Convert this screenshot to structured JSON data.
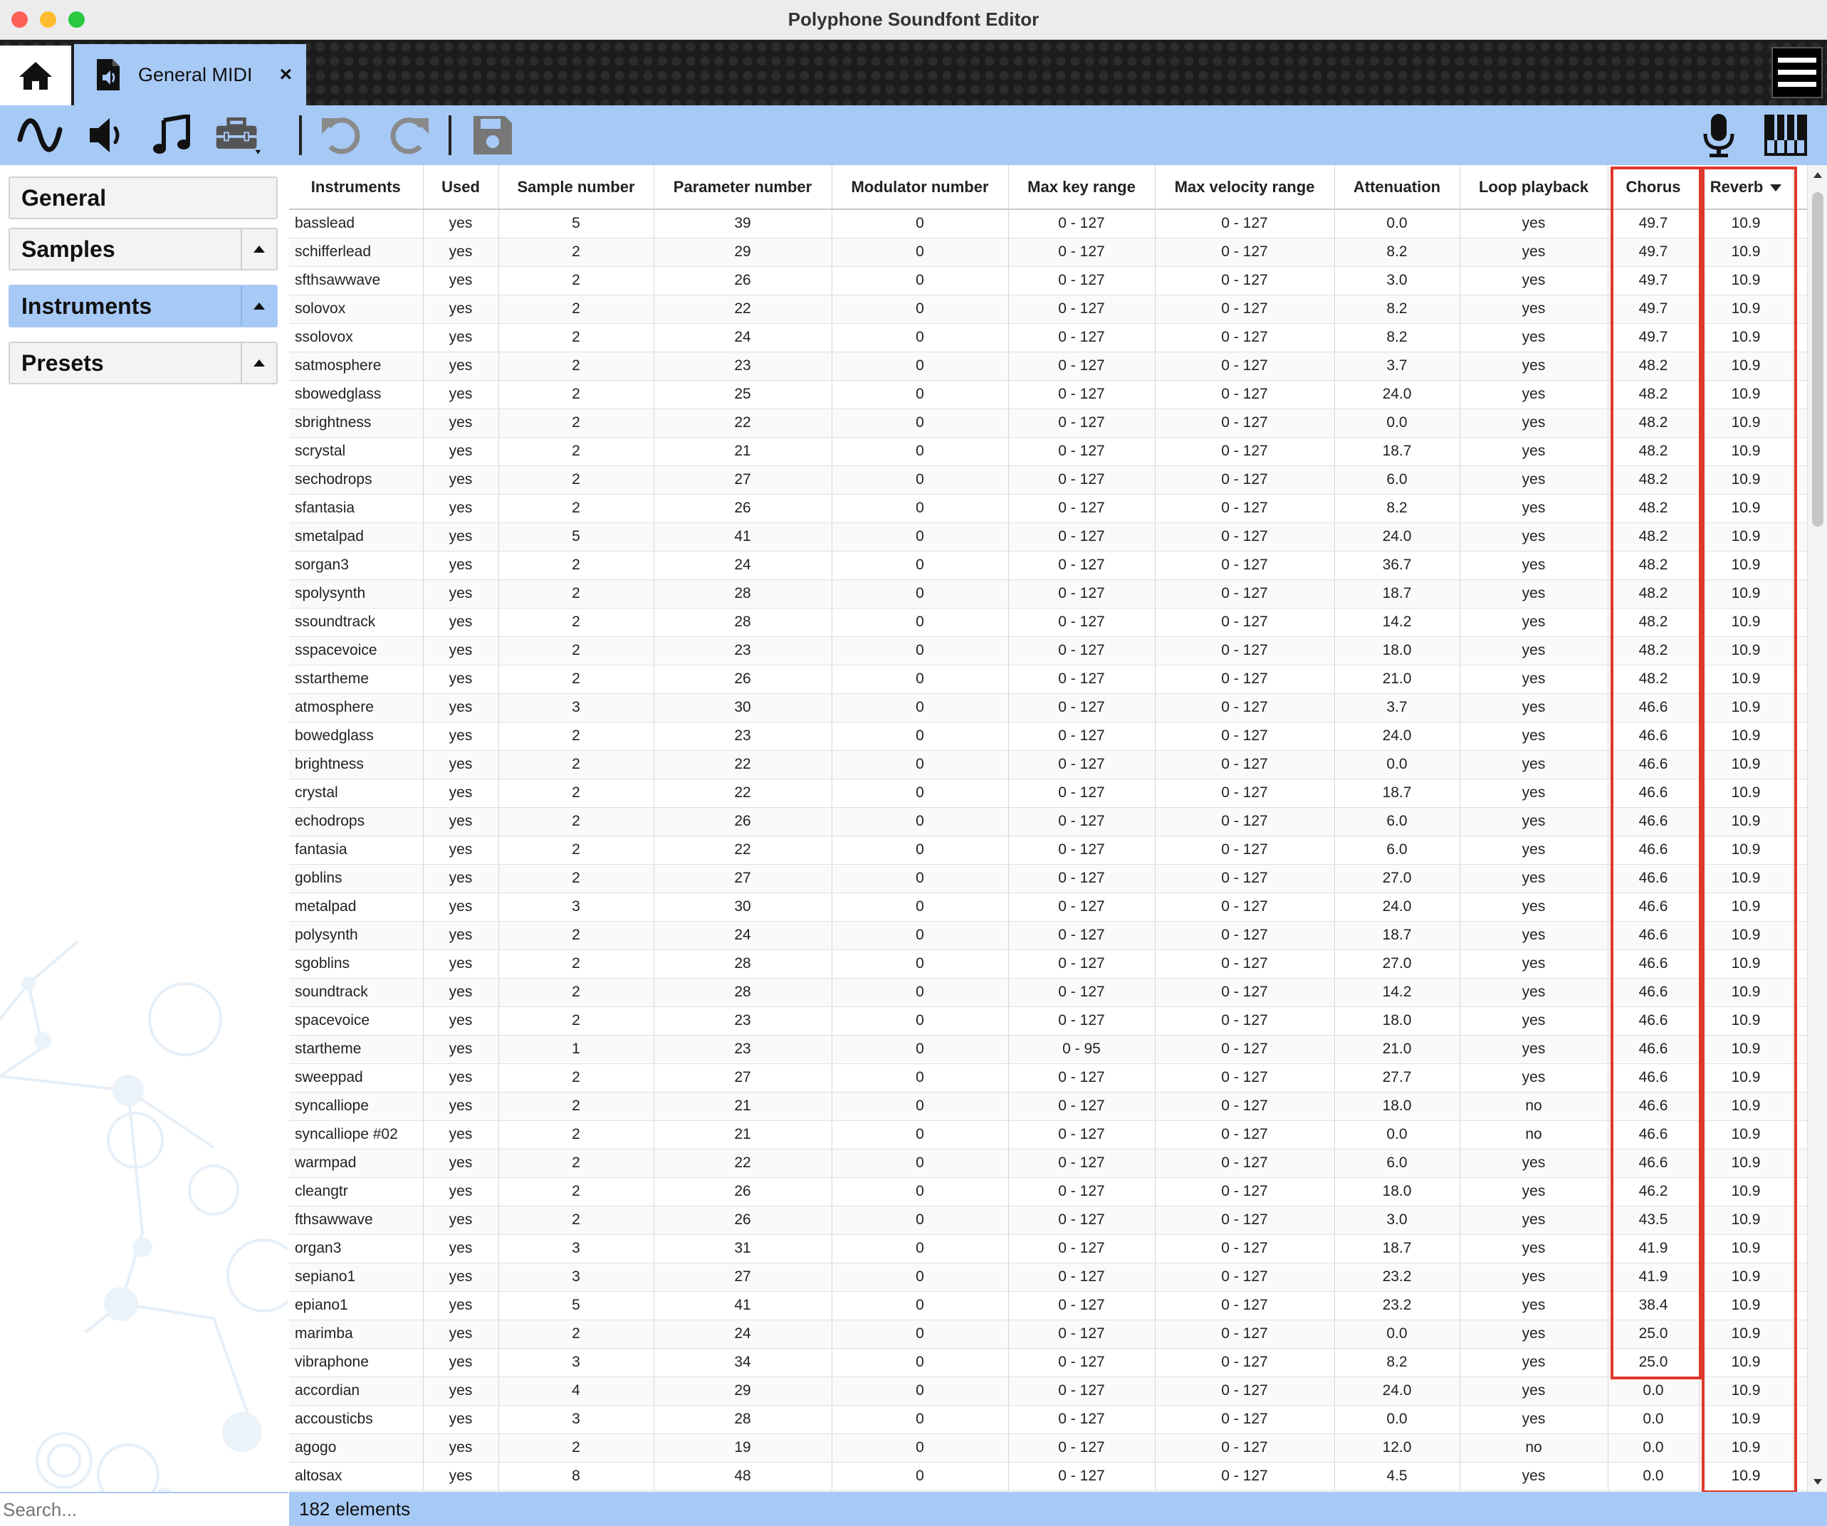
{
  "window": {
    "title": "Polyphone Soundfont Editor"
  },
  "tabs": {
    "home_icon": "home-icon",
    "doc_label": "General MIDI",
    "close_glyph": "×"
  },
  "toolbar": {
    "icons": [
      "waveform-icon",
      "speaker-icon",
      "music-note-icon",
      "toolbox-icon",
      "undo-icon",
      "redo-icon",
      "save-icon",
      "microphone-icon",
      "piano-keys-icon"
    ]
  },
  "sidebar": {
    "items": [
      {
        "label": "General",
        "has_toggle": false,
        "active": false
      },
      {
        "label": "Samples",
        "has_toggle": true,
        "active": false
      },
      {
        "label": "Instruments",
        "has_toggle": true,
        "active": true
      },
      {
        "label": "Presets",
        "has_toggle": true,
        "active": false
      }
    ],
    "search_placeholder": "Search..."
  },
  "table": {
    "columns": [
      "Instruments",
      "Used",
      "Sample number",
      "Parameter number",
      "Modulator number",
      "Max key range",
      "Max velocity range",
      "Attenuation",
      "Loop playback",
      "Chorus",
      "Reverb"
    ],
    "sorted_column": "Reverb",
    "highlighted_columns": [
      "Chorus",
      "Reverb"
    ],
    "rows": [
      [
        "basslead",
        "yes",
        "5",
        "39",
        "0",
        "0 - 127",
        "0 - 127",
        "0.0",
        "yes",
        "49.7",
        "10.9"
      ],
      [
        "schifferlead",
        "yes",
        "2",
        "29",
        "0",
        "0 - 127",
        "0 - 127",
        "8.2",
        "yes",
        "49.7",
        "10.9"
      ],
      [
        "sfthsawwave",
        "yes",
        "2",
        "26",
        "0",
        "0 - 127",
        "0 - 127",
        "3.0",
        "yes",
        "49.7",
        "10.9"
      ],
      [
        "solovox",
        "yes",
        "2",
        "22",
        "0",
        "0 - 127",
        "0 - 127",
        "8.2",
        "yes",
        "49.7",
        "10.9"
      ],
      [
        "ssolovox",
        "yes",
        "2",
        "24",
        "0",
        "0 - 127",
        "0 - 127",
        "8.2",
        "yes",
        "49.7",
        "10.9"
      ],
      [
        "satmosphere",
        "yes",
        "2",
        "23",
        "0",
        "0 - 127",
        "0 - 127",
        "3.7",
        "yes",
        "48.2",
        "10.9"
      ],
      [
        "sbowedglass",
        "yes",
        "2",
        "25",
        "0",
        "0 - 127",
        "0 - 127",
        "24.0",
        "yes",
        "48.2",
        "10.9"
      ],
      [
        "sbrightness",
        "yes",
        "2",
        "22",
        "0",
        "0 - 127",
        "0 - 127",
        "0.0",
        "yes",
        "48.2",
        "10.9"
      ],
      [
        "scrystal",
        "yes",
        "2",
        "21",
        "0",
        "0 - 127",
        "0 - 127",
        "18.7",
        "yes",
        "48.2",
        "10.9"
      ],
      [
        "sechodrops",
        "yes",
        "2",
        "27",
        "0",
        "0 - 127",
        "0 - 127",
        "6.0",
        "yes",
        "48.2",
        "10.9"
      ],
      [
        "sfantasia",
        "yes",
        "2",
        "26",
        "0",
        "0 - 127",
        "0 - 127",
        "8.2",
        "yes",
        "48.2",
        "10.9"
      ],
      [
        "smetalpad",
        "yes",
        "5",
        "41",
        "0",
        "0 - 127",
        "0 - 127",
        "24.0",
        "yes",
        "48.2",
        "10.9"
      ],
      [
        "sorgan3",
        "yes",
        "2",
        "24",
        "0",
        "0 - 127",
        "0 - 127",
        "36.7",
        "yes",
        "48.2",
        "10.9"
      ],
      [
        "spolysynth",
        "yes",
        "2",
        "28",
        "0",
        "0 - 127",
        "0 - 127",
        "18.7",
        "yes",
        "48.2",
        "10.9"
      ],
      [
        "ssoundtrack",
        "yes",
        "2",
        "28",
        "0",
        "0 - 127",
        "0 - 127",
        "14.2",
        "yes",
        "48.2",
        "10.9"
      ],
      [
        "sspacevoice",
        "yes",
        "2",
        "23",
        "0",
        "0 - 127",
        "0 - 127",
        "18.0",
        "yes",
        "48.2",
        "10.9"
      ],
      [
        "sstartheme",
        "yes",
        "2",
        "26",
        "0",
        "0 - 127",
        "0 - 127",
        "21.0",
        "yes",
        "48.2",
        "10.9"
      ],
      [
        "atmosphere",
        "yes",
        "3",
        "30",
        "0",
        "0 - 127",
        "0 - 127",
        "3.7",
        "yes",
        "46.6",
        "10.9"
      ],
      [
        "bowedglass",
        "yes",
        "2",
        "23",
        "0",
        "0 - 127",
        "0 - 127",
        "24.0",
        "yes",
        "46.6",
        "10.9"
      ],
      [
        "brightness",
        "yes",
        "2",
        "22",
        "0",
        "0 - 127",
        "0 - 127",
        "0.0",
        "yes",
        "46.6",
        "10.9"
      ],
      [
        "crystal",
        "yes",
        "2",
        "22",
        "0",
        "0 - 127",
        "0 - 127",
        "18.7",
        "yes",
        "46.6",
        "10.9"
      ],
      [
        "echodrops",
        "yes",
        "2",
        "26",
        "0",
        "0 - 127",
        "0 - 127",
        "6.0",
        "yes",
        "46.6",
        "10.9"
      ],
      [
        "fantasia",
        "yes",
        "2",
        "22",
        "0",
        "0 - 127",
        "0 - 127",
        "6.0",
        "yes",
        "46.6",
        "10.9"
      ],
      [
        "goblins",
        "yes",
        "2",
        "27",
        "0",
        "0 - 127",
        "0 - 127",
        "27.0",
        "yes",
        "46.6",
        "10.9"
      ],
      [
        "metalpad",
        "yes",
        "3",
        "30",
        "0",
        "0 - 127",
        "0 - 127",
        "24.0",
        "yes",
        "46.6",
        "10.9"
      ],
      [
        "polysynth",
        "yes",
        "2",
        "24",
        "0",
        "0 - 127",
        "0 - 127",
        "18.7",
        "yes",
        "46.6",
        "10.9"
      ],
      [
        "sgoblins",
        "yes",
        "2",
        "28",
        "0",
        "0 - 127",
        "0 - 127",
        "27.0",
        "yes",
        "46.6",
        "10.9"
      ],
      [
        "soundtrack",
        "yes",
        "2",
        "28",
        "0",
        "0 - 127",
        "0 - 127",
        "14.2",
        "yes",
        "46.6",
        "10.9"
      ],
      [
        "spacevoice",
        "yes",
        "2",
        "23",
        "0",
        "0 - 127",
        "0 - 127",
        "18.0",
        "yes",
        "46.6",
        "10.9"
      ],
      [
        "startheme",
        "yes",
        "1",
        "23",
        "0",
        "0 - 95",
        "0 - 127",
        "21.0",
        "yes",
        "46.6",
        "10.9"
      ],
      [
        "sweeppad",
        "yes",
        "2",
        "27",
        "0",
        "0 - 127",
        "0 - 127",
        "27.7",
        "yes",
        "46.6",
        "10.9"
      ],
      [
        "syncalliope",
        "yes",
        "2",
        "21",
        "0",
        "0 - 127",
        "0 - 127",
        "18.0",
        "no",
        "46.6",
        "10.9"
      ],
      [
        "syncalliope #02",
        "yes",
        "2",
        "21",
        "0",
        "0 - 127",
        "0 - 127",
        "0.0",
        "no",
        "46.6",
        "10.9"
      ],
      [
        "warmpad",
        "yes",
        "2",
        "22",
        "0",
        "0 - 127",
        "0 - 127",
        "6.0",
        "yes",
        "46.6",
        "10.9"
      ],
      [
        "cleangtr",
        "yes",
        "2",
        "26",
        "0",
        "0 - 127",
        "0 - 127",
        "18.0",
        "yes",
        "46.2",
        "10.9"
      ],
      [
        "fthsawwave",
        "yes",
        "2",
        "26",
        "0",
        "0 - 127",
        "0 - 127",
        "3.0",
        "yes",
        "43.5",
        "10.9"
      ],
      [
        "organ3",
        "yes",
        "3",
        "31",
        "0",
        "0 - 127",
        "0 - 127",
        "18.7",
        "yes",
        "41.9",
        "10.9"
      ],
      [
        "sepiano1",
        "yes",
        "3",
        "27",
        "0",
        "0 - 127",
        "0 - 127",
        "23.2",
        "yes",
        "41.9",
        "10.9"
      ],
      [
        "epiano1",
        "yes",
        "5",
        "41",
        "0",
        "0 - 127",
        "0 - 127",
        "23.2",
        "yes",
        "38.4",
        "10.9"
      ],
      [
        "marimba",
        "yes",
        "2",
        "24",
        "0",
        "0 - 127",
        "0 - 127",
        "0.0",
        "yes",
        "25.0",
        "10.9"
      ],
      [
        "vibraphone",
        "yes",
        "3",
        "34",
        "0",
        "0 - 127",
        "0 - 127",
        "8.2",
        "yes",
        "25.0",
        "10.9"
      ],
      [
        "accordian",
        "yes",
        "4",
        "29",
        "0",
        "0 - 127",
        "0 - 127",
        "24.0",
        "yes",
        "0.0",
        "10.9"
      ],
      [
        "accousticbs",
        "yes",
        "3",
        "28",
        "0",
        "0 - 127",
        "0 - 127",
        "0.0",
        "yes",
        "0.0",
        "10.9"
      ],
      [
        "agogo",
        "yes",
        "2",
        "19",
        "0",
        "0 - 127",
        "0 - 127",
        "12.0",
        "no",
        "0.0",
        "10.9"
      ],
      [
        "altosax",
        "yes",
        "8",
        "48",
        "0",
        "0 - 127",
        "0 - 127",
        "4.5",
        "yes",
        "0.0",
        "10.9"
      ]
    ]
  },
  "status": {
    "count_text": "182 elements"
  },
  "colors": {
    "accent": "#a7c9f6",
    "highlight": "#e0372b",
    "tabbar": "#1c1c1c"
  }
}
